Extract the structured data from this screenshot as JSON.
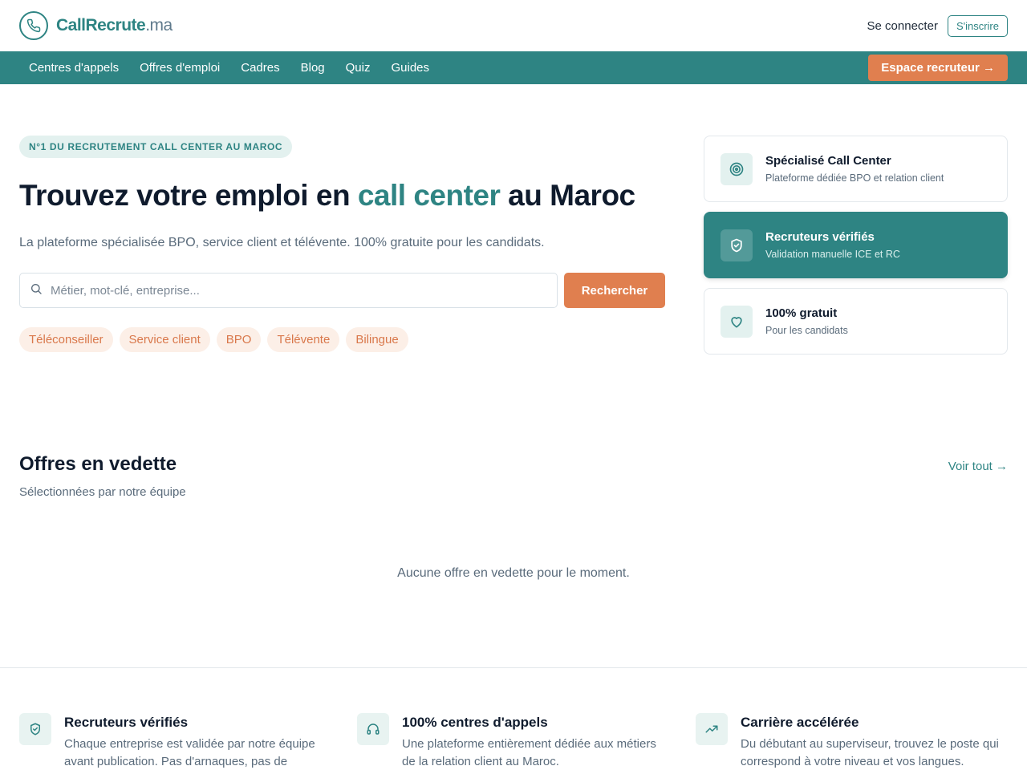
{
  "brand": {
    "name_main": "CallRecrute",
    "name_tld": ".ma"
  },
  "header": {
    "login_label": "Se connecter",
    "signup_label": "S'inscrire"
  },
  "nav": {
    "items": [
      "Centres d'appels",
      "Offres d'emploi",
      "Cadres",
      "Blog",
      "Quiz",
      "Guides"
    ],
    "recruiter_label": "Espace recruteur →"
  },
  "hero": {
    "badge": "N°1 DU RECRUTEMENT CALL CENTER AU MAROC",
    "title_before": "Trouvez votre emploi en ",
    "title_accent": "call center",
    "title_after": " au Maroc",
    "subtitle": "La plateforme spécialisée BPO, service client et télévente. 100% gratuite pour les candidats.",
    "search_placeholder": "Métier, mot-clé, entreprise...",
    "search_button": "Rechercher",
    "tags": [
      "Téléconseiller",
      "Service client",
      "BPO",
      "Télévente",
      "Bilingue"
    ]
  },
  "features": [
    {
      "title": "Spécialisé Call Center",
      "desc": "Plateforme dédiée BPO et relation client",
      "icon": "target-icon",
      "active": false
    },
    {
      "title": "Recruteurs vérifiés",
      "desc": "Validation manuelle ICE et RC",
      "icon": "shield-check-icon",
      "active": true
    },
    {
      "title": "100% gratuit",
      "desc": "Pour les candidats",
      "icon": "heart-icon",
      "active": false
    }
  ],
  "offers": {
    "title": "Offres en vedette",
    "subtitle": "Sélectionnées par notre équipe",
    "see_all": "Voir tout →",
    "empty": "Aucune offre en vedette pour le moment."
  },
  "benefits": [
    {
      "title": "Recruteurs vérifiés",
      "desc": "Chaque entreprise est validée par notre équipe avant publication. Pas d'arnaques, pas de",
      "icon": "shield-check-icon"
    },
    {
      "title": "100% centres d'appels",
      "desc": "Une plateforme entièrement dédiée aux métiers de la relation client au Maroc.",
      "icon": "headphones-icon"
    },
    {
      "title": "Carrière accélérée",
      "desc": "Du débutant au superviseur, trouvez le poste qui correspond à votre niveau et vos langues.",
      "icon": "trending-up-icon"
    }
  ],
  "colors": {
    "primary": "#2e8483",
    "accent": "#e07f4f",
    "tag_bg": "#fcefe7"
  }
}
